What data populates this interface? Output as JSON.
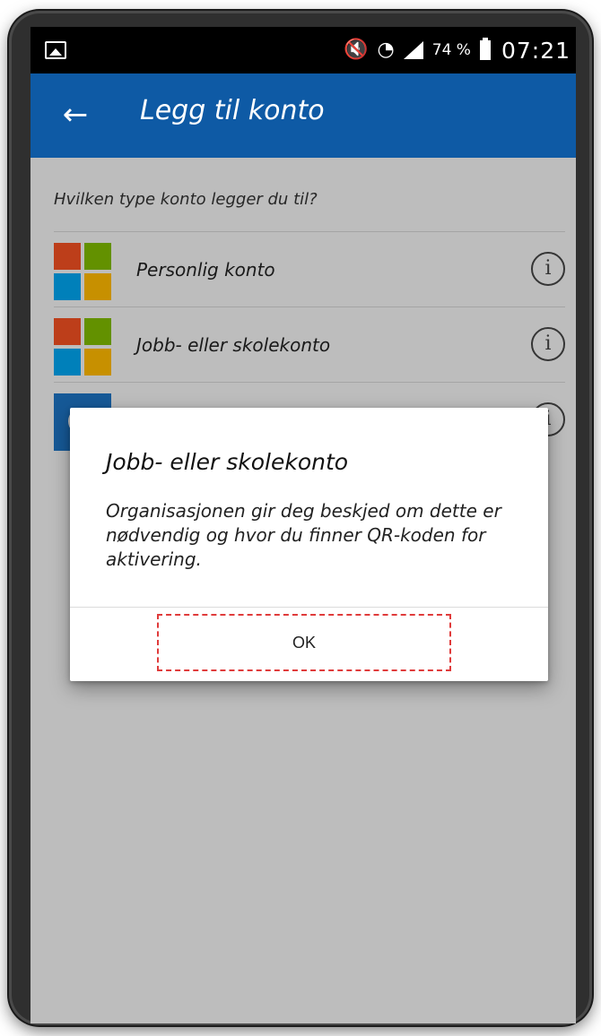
{
  "status_bar": {
    "battery_percent": "74 %",
    "time": "07:21"
  },
  "app_bar": {
    "title": "Legg til konto"
  },
  "content": {
    "question": "Hvilken type konto legger du til?",
    "items": [
      {
        "label": "Personlig konto"
      },
      {
        "label": "Jobb- eller skolekonto"
      }
    ]
  },
  "dialog": {
    "title": "Jobb- eller skolekonto",
    "message": "Organisasjonen gir deg beskjed om dette er nødvendig og hvor du finner QR-koden for aktivering.",
    "ok_label": "OK"
  },
  "colors": {
    "app_bar": "#0e5aa5",
    "highlight_border": "#e03b3b"
  }
}
